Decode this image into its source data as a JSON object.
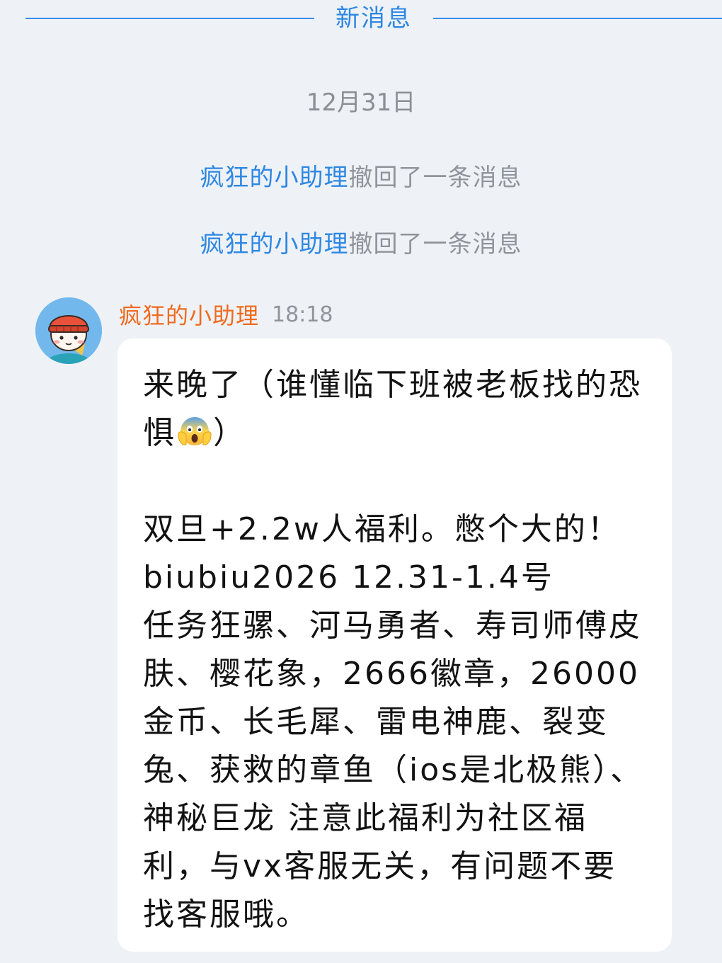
{
  "divider": {
    "label": "新消息",
    "color": "#2e87e3"
  },
  "date_label": "12月31日",
  "system_notices": [
    {
      "who": "疯狂的小助理",
      "what": "撤回了一条消息"
    },
    {
      "who": "疯狂的小助理",
      "what": "撤回了一条消息"
    }
  ],
  "message": {
    "avatar_icon": "avatar-cartoon-red-hat-icon",
    "sender": "疯狂的小助理",
    "time": "18:18",
    "text_before_emoji": "来晚了（谁懂临下班被老板找的恐惧",
    "emoji_icon": "face-screaming-in-fear-icon",
    "text_after_emoji": "）\n\n双旦+2.2w人福利。憋个大的！\nbiubiu2026 12.31-1.4号\n任务狂骡、河马勇者、寿司师傅皮肤、樱花象，2666徽章，26000金币、长毛犀、雷电神鹿、裂变兔、获救的章鱼（ios是北极熊）、神秘巨龙 注意此福利为社区福利，与vx客服无关，有问题不要找客服哦。"
  },
  "colors": {
    "background": "#eef2f7",
    "accent": "#2e87e3",
    "sender_name": "#f06a1d",
    "muted_text": "#8f949b",
    "bubble": "#ffffff"
  }
}
